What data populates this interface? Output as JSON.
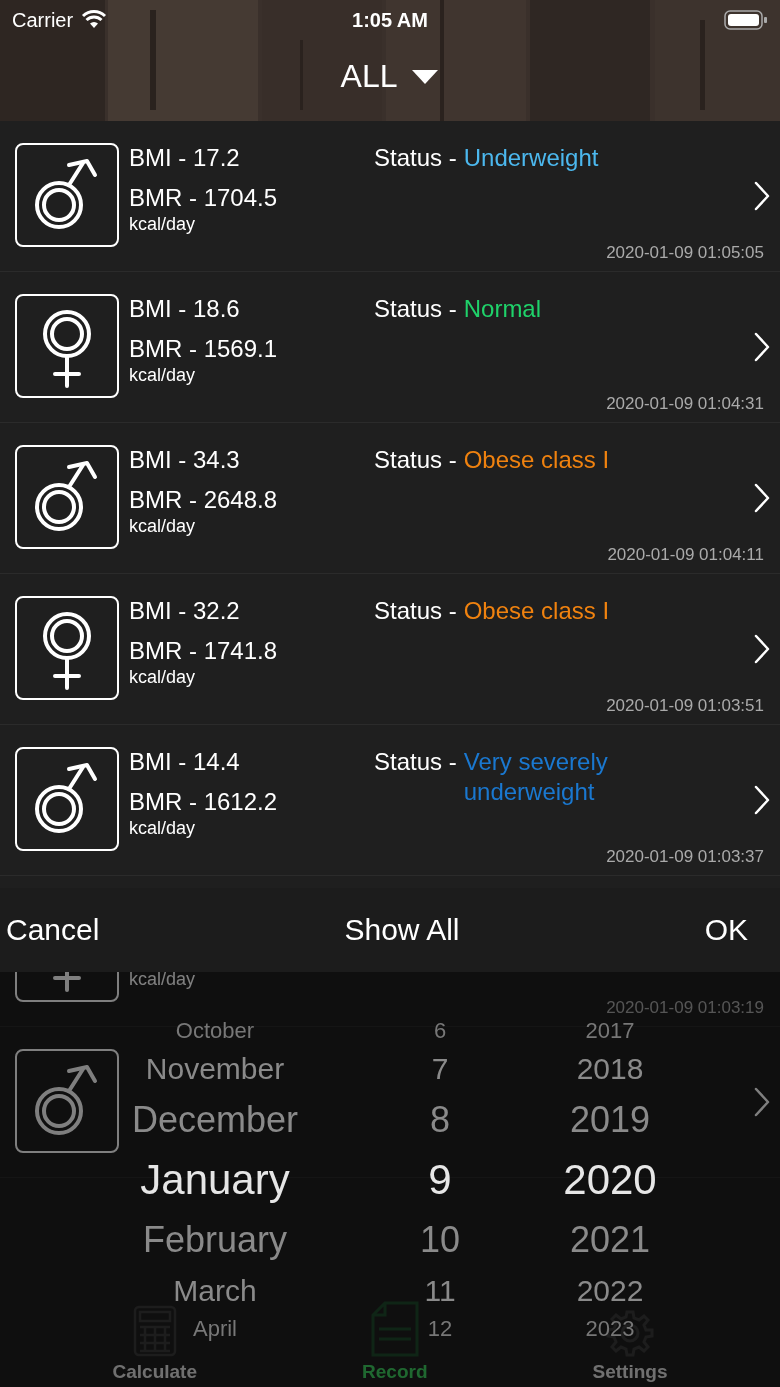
{
  "status_bar": {
    "carrier": "Carrier",
    "time": "1:05 AM"
  },
  "header": {
    "title": "ALL"
  },
  "records": [
    {
      "kind": "male",
      "bmi": "BMI - 17.2",
      "bmr": "BMR - 1704.5",
      "unit": "kcal/day",
      "status_label": "Status -",
      "status": "Underweight",
      "color": "#4cb8ee",
      "time": "2020-01-09 01:05:05"
    },
    {
      "kind": "female",
      "bmi": "BMI - 18.6",
      "bmr": "BMR - 1569.1",
      "unit": "kcal/day",
      "status_label": "Status -",
      "status": "Normal",
      "color": "#1fd26a",
      "time": "2020-01-09 01:04:31"
    },
    {
      "kind": "male",
      "bmi": "BMI - 34.3",
      "bmr": "BMR - 2648.8",
      "unit": "kcal/day",
      "status_label": "Status -",
      "status": "Obese class I",
      "color": "#f0820f",
      "time": "2020-01-09 01:04:11"
    },
    {
      "kind": "female",
      "bmi": "BMI - 32.2",
      "bmr": "BMR - 1741.8",
      "unit": "kcal/day",
      "status_label": "Status -",
      "status": "Obese class I",
      "color": "#f0820f",
      "time": "2020-01-09 01:03:51"
    },
    {
      "kind": "male",
      "bmi": "BMI - 14.4",
      "bmr": "BMR - 1612.2",
      "unit": "kcal/day",
      "status_label": "Status -",
      "status": "Very severely underweight",
      "color": "#1a78d0",
      "time": "2020-01-09 01:03:37"
    },
    {
      "kind": "female",
      "unit": "kcal/day",
      "time": "2020-01-09 01:03:19"
    },
    {
      "kind": "male"
    }
  ],
  "toolbar": {
    "cancel": "Cancel",
    "show_all": "Show All",
    "ok": "OK"
  },
  "picker": {
    "months": [
      {
        "label": "October",
        "selected": false
      },
      {
        "label": "November",
        "selected": false
      },
      {
        "label": "December",
        "selected": false
      },
      {
        "label": "January",
        "selected": true
      },
      {
        "label": "February",
        "selected": false
      },
      {
        "label": "March",
        "selected": false
      },
      {
        "label": "April",
        "selected": false
      }
    ],
    "days": [
      {
        "label": "6",
        "selected": false
      },
      {
        "label": "7",
        "selected": false
      },
      {
        "label": "8",
        "selected": false
      },
      {
        "label": "9",
        "selected": true
      },
      {
        "label": "10",
        "selected": false
      },
      {
        "label": "11",
        "selected": false
      },
      {
        "label": "12",
        "selected": false
      }
    ],
    "years": [
      {
        "label": "2017",
        "selected": false
      },
      {
        "label": "2018",
        "selected": false
      },
      {
        "label": "2019",
        "selected": false
      },
      {
        "label": "2020",
        "selected": true
      },
      {
        "label": "2021",
        "selected": false
      },
      {
        "label": "2022",
        "selected": false
      },
      {
        "label": "2023",
        "selected": false
      }
    ]
  },
  "tab_bar": [
    {
      "label": "Calculate",
      "kind": "calculator",
      "selected": false
    },
    {
      "label": "Record",
      "kind": "document",
      "selected": true
    },
    {
      "label": "Settings",
      "kind": "gear",
      "selected": false
    }
  ]
}
